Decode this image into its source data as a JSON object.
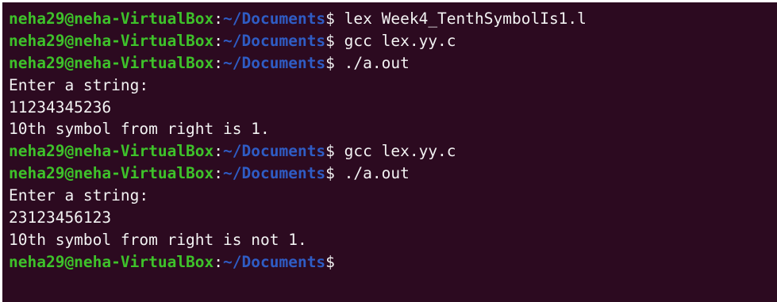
{
  "terminal": {
    "prompt": {
      "user_host": "neha29@neha-VirtualBox",
      "separator": ":",
      "path": "~/Documents",
      "symbol": "$"
    },
    "lines": [
      {
        "type": "prompt",
        "command": " lex Week4_TenthSymbolIs1.l"
      },
      {
        "type": "prompt",
        "command": " gcc lex.yy.c"
      },
      {
        "type": "prompt",
        "command": " ./a.out"
      },
      {
        "type": "output",
        "text": "Enter a string:"
      },
      {
        "type": "output",
        "text": "11234345236"
      },
      {
        "type": "output",
        "text": "10th symbol from right is 1."
      },
      {
        "type": "prompt",
        "command": " gcc lex.yy.c"
      },
      {
        "type": "prompt",
        "command": " ./a.out"
      },
      {
        "type": "output",
        "text": "Enter a string:"
      },
      {
        "type": "output",
        "text": "23123456123"
      },
      {
        "type": "output",
        "text": "10th symbol from right is not 1."
      },
      {
        "type": "prompt",
        "command": ""
      }
    ],
    "colors": {
      "background": "#2c0a20",
      "user_host": "#3ec22a",
      "path": "#2f5cc4",
      "text": "#f3f3f3"
    }
  }
}
